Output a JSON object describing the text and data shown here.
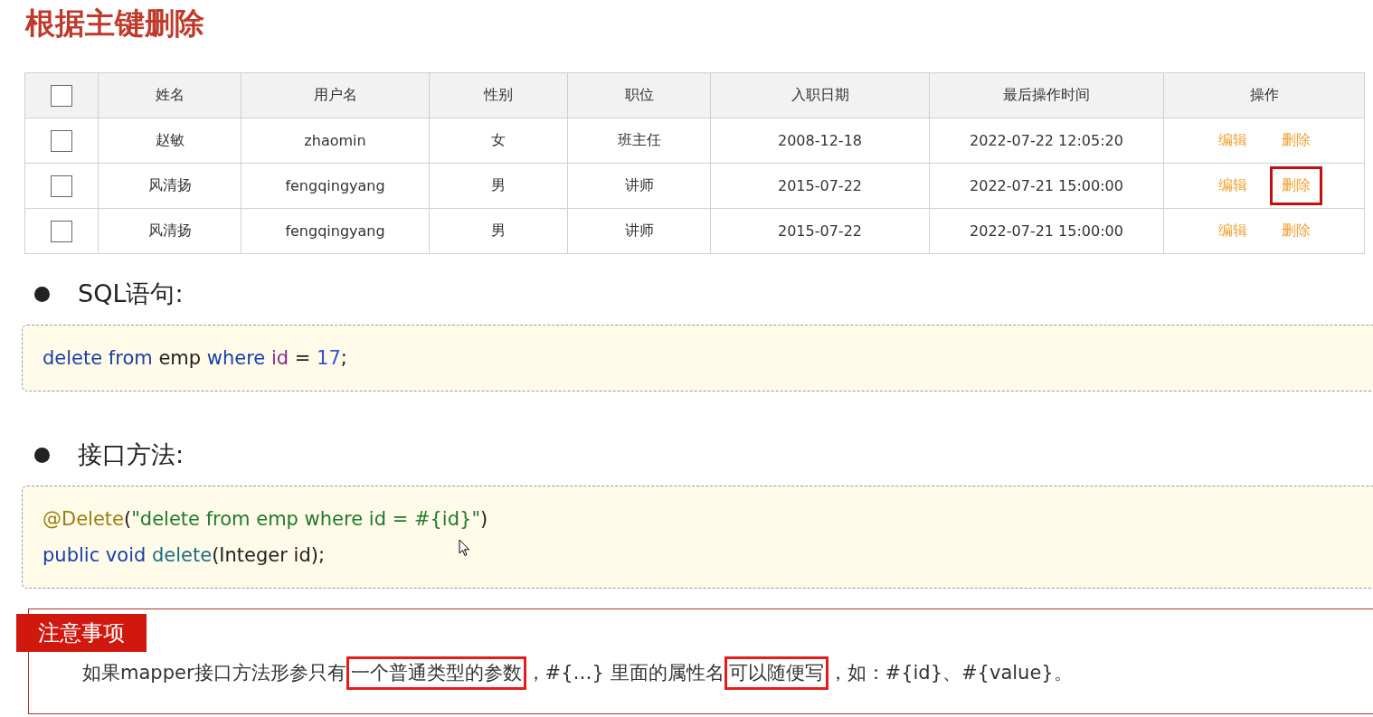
{
  "title": "根据主键删除",
  "table": {
    "header_checkbox": {
      "checked": false
    },
    "columns": [
      "姓名",
      "用户名",
      "性别",
      "职位",
      "入职日期",
      "最后操作时间",
      "操作"
    ],
    "rows": [
      {
        "checked": false,
        "cells": [
          "赵敏",
          "zhaomin",
          "女",
          "班主任",
          "2008-12-18",
          "2022-07-22 12:05:20"
        ],
        "actions": [
          {
            "label": "编辑",
            "highlighted": false
          },
          {
            "label": "删除",
            "highlighted": false
          }
        ]
      },
      {
        "checked": false,
        "cells": [
          "风清扬",
          "fengqingyang",
          "男",
          "讲师",
          "2015-07-22",
          "2022-07-21 15:00:00"
        ],
        "actions": [
          {
            "label": "编辑",
            "highlighted": false
          },
          {
            "label": "删除",
            "highlighted": true
          }
        ]
      },
      {
        "checked": false,
        "cells": [
          "风清扬",
          "fengqingyang",
          "男",
          "讲师",
          "2015-07-22",
          "2022-07-21 15:00:00"
        ],
        "actions": [
          {
            "label": "编辑",
            "highlighted": false
          },
          {
            "label": "删除",
            "highlighted": false
          }
        ]
      }
    ]
  },
  "sections": [
    {
      "heading": "SQL语句:",
      "code_lines": [
        [
          {
            "kind": "keyword",
            "text": "delete from"
          },
          {
            "kind": "plain",
            "text": " emp "
          },
          {
            "kind": "keyword",
            "text": "where "
          },
          {
            "kind": "column",
            "text": "id"
          },
          {
            "kind": "plain",
            "text": " = "
          },
          {
            "kind": "number",
            "text": "17"
          },
          {
            "kind": "plain",
            "text": ";"
          }
        ]
      ]
    },
    {
      "heading": "接口方法:",
      "code_lines": [
        [
          {
            "kind": "annotation",
            "text": "@Delete"
          },
          {
            "kind": "plain",
            "text": "("
          },
          {
            "kind": "string",
            "text": "\"delete from emp where id = #{id}\""
          },
          {
            "kind": "plain",
            "text": ")"
          }
        ],
        [
          {
            "kind": "keyword",
            "text": "public void "
          },
          {
            "kind": "method",
            "text": "delete"
          },
          {
            "kind": "plain",
            "text": "(Integer id);"
          }
        ]
      ]
    }
  ],
  "note": {
    "label": "注意事项",
    "segments": [
      {
        "text": "如果mapper接口方法形参只有",
        "boxed": false
      },
      {
        "text": "一个普通类型的参数",
        "boxed": true
      },
      {
        "text": "，#{…} 里面的属性名",
        "boxed": false
      },
      {
        "text": "可以随便写",
        "boxed": true
      },
      {
        "text": "，如：#{id}、#{value}。",
        "boxed": false
      }
    ]
  }
}
